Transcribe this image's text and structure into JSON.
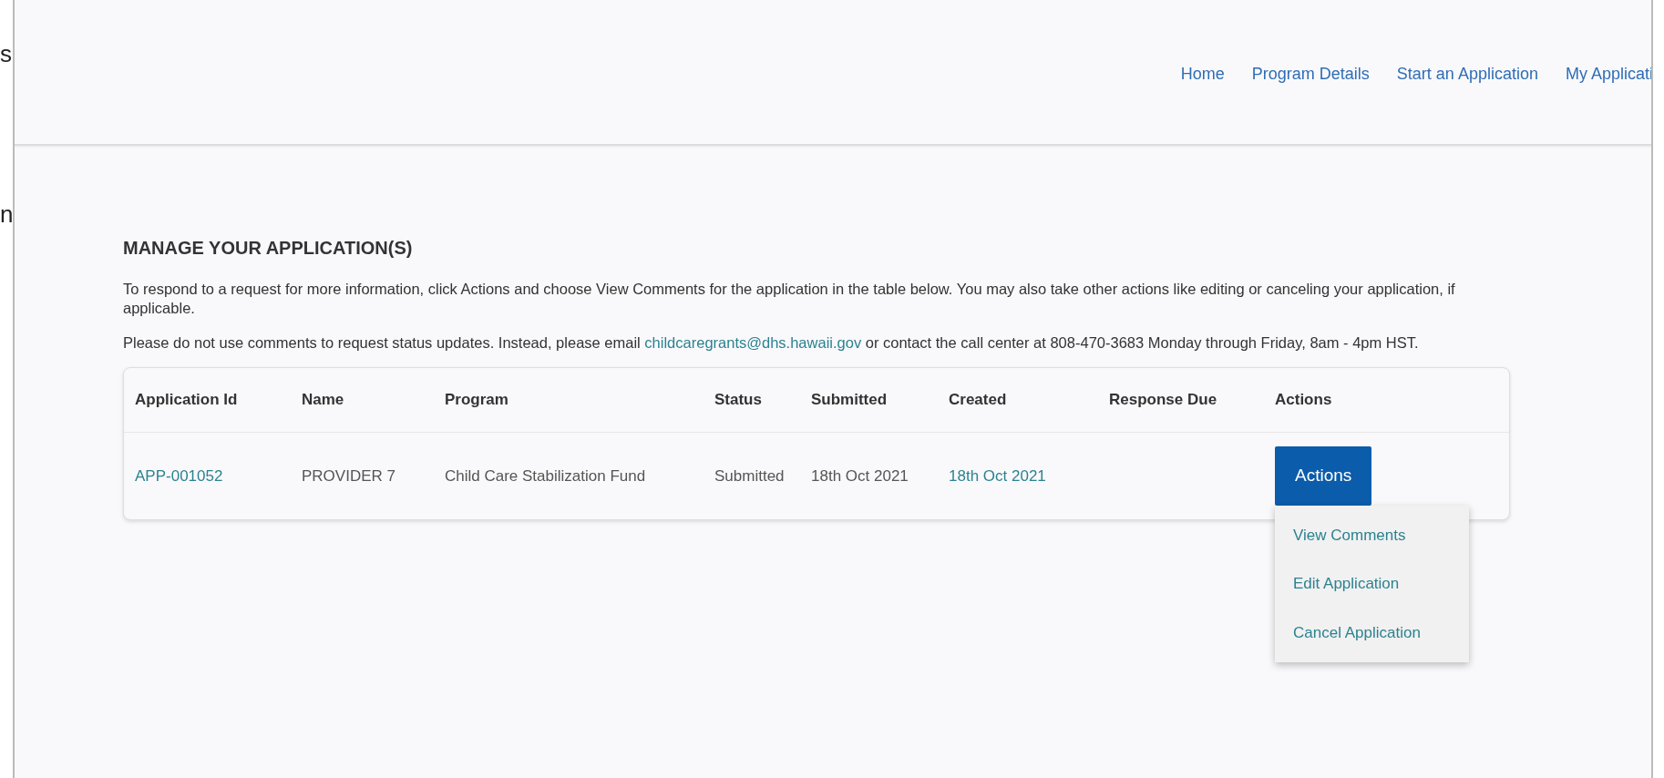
{
  "edge_fragments": [
    "s",
    "n"
  ],
  "nav": {
    "links": [
      "Home",
      "Program Details",
      "Start an Application",
      "My Applicati"
    ]
  },
  "page": {
    "heading": "MANAGE YOUR APPLICATION(S)",
    "paragraphs": [
      {
        "segments": [
          {
            "kind": "text",
            "text": "To respond to a request for more information, click Actions and choose View Comments for the application in the table below. You may also take other actions like editing or canceling your application, if applicable."
          }
        ]
      },
      {
        "segments": [
          {
            "kind": "text",
            "text": "Please do not use comments to request status updates. Instead, please email"
          },
          {
            "kind": "link",
            "text": "childcaregrants@dhs.hawaii.gov"
          },
          {
            "kind": "text",
            "text": "or contact the call center at 808-470-3683 Monday through Friday, 8am - 4pm HST."
          }
        ]
      }
    ]
  },
  "table": {
    "columns": [
      "Application Id",
      "Name",
      "Program",
      "Status",
      "Submitted",
      "Created",
      "Response Due",
      "Actions"
    ],
    "rows": [
      {
        "cells": [
          {
            "text": "APP-001052",
            "kind": "link"
          },
          {
            "text": "PROVIDER 7",
            "kind": "text"
          },
          {
            "text": "Child Care Stabilization Fund",
            "kind": "text"
          },
          {
            "text": "Submitted",
            "kind": "text"
          },
          {
            "text": "18th Oct 2021",
            "kind": "text"
          },
          {
            "text": "18th Oct 2021",
            "kind": "link"
          },
          {
            "kind": "empty"
          },
          {
            "text": "Actions",
            "kind": "button"
          }
        ],
        "menu": {
          "expanded": true,
          "items": [
            "View Comments",
            "Edit Application",
            "Cancel Application"
          ]
        }
      }
    ]
  }
}
